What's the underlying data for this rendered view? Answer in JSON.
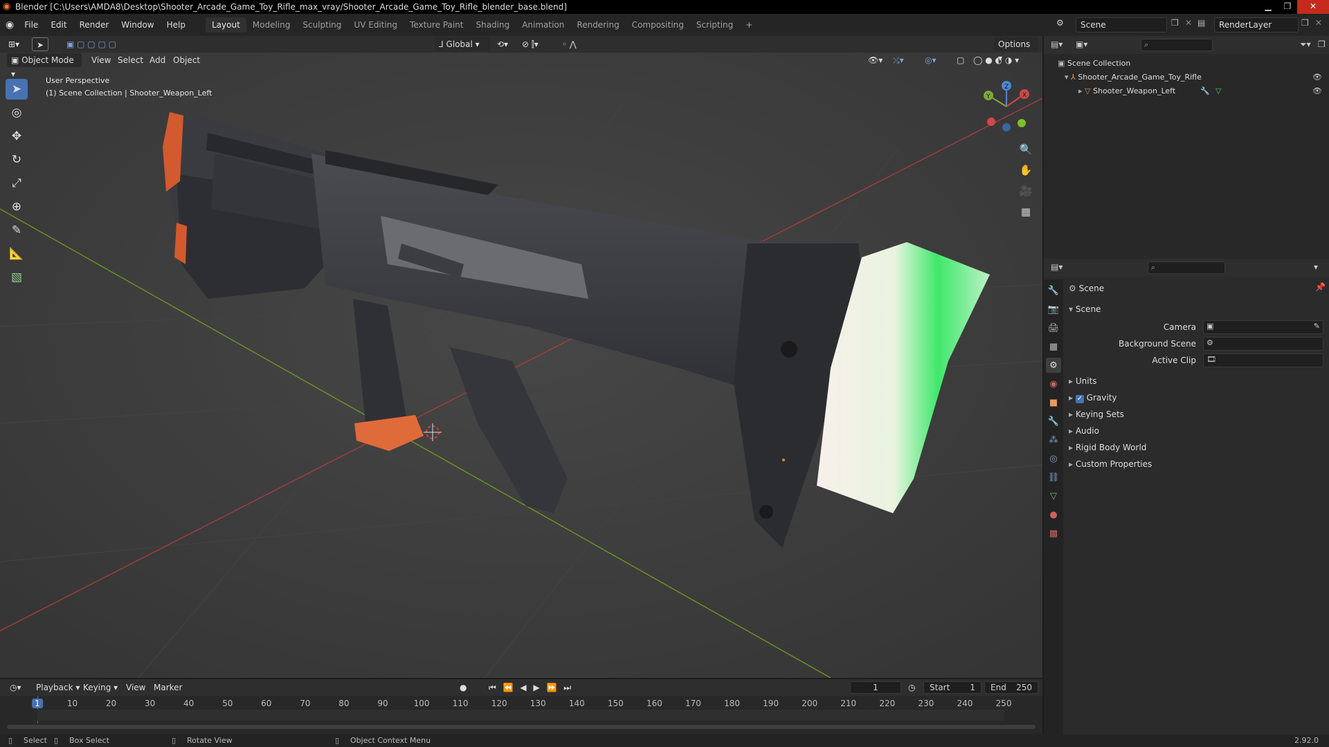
{
  "window": {
    "title": "Blender [C:\\Users\\AMDA8\\Desktop\\Shooter_Arcade_Game_Toy_Rifle_max_vray/Shooter_Arcade_Game_Toy_Rifle_blender_base.blend]"
  },
  "menu": [
    "File",
    "Edit",
    "Render",
    "Window",
    "Help"
  ],
  "workspaces": [
    "Layout",
    "Modeling",
    "Sculpting",
    "UV Editing",
    "Texture Paint",
    "Shading",
    "Animation",
    "Rendering",
    "Compositing",
    "Scripting"
  ],
  "active_workspace": "Layout",
  "add_workspace": "+",
  "scene_selector": {
    "value": "Scene"
  },
  "view_layer_selector": {
    "value": "RenderLayer"
  },
  "viewport": {
    "transform_orientation": "Global",
    "options_label": "Options",
    "mode": "Object Mode",
    "menus": [
      "View",
      "Select",
      "Add",
      "Object"
    ],
    "overlay_line1": "User Perspective",
    "overlay_line2": "(1) Scene Collection | Shooter_Weapon_Left"
  },
  "gizmo": {
    "x": "X",
    "y": "Y",
    "z": "Z"
  },
  "outliner": {
    "root": "Scene Collection",
    "items": [
      {
        "name": "Shooter_Arcade_Game_Toy_Rifle"
      },
      {
        "name": "Shooter_Weapon_Left"
      }
    ]
  },
  "properties": {
    "header_title": "Scene",
    "panel_title": "Scene",
    "fields": [
      {
        "label": "Camera",
        "value": ""
      },
      {
        "label": "Background Scene",
        "value": ""
      },
      {
        "label": "Active Clip",
        "value": ""
      }
    ],
    "panels": [
      "Units",
      "Gravity",
      "Keying Sets",
      "Audio",
      "Rigid Body World",
      "Custom Properties"
    ],
    "gravity_checked": true
  },
  "timeline": {
    "menus": [
      "Playback",
      "Keying",
      "View",
      "Marker"
    ],
    "current_frame": "1",
    "start_label": "Start",
    "start_value": "1",
    "end_label": "End",
    "end_value": "250",
    "ruler": [
      "1",
      "10",
      "20",
      "30",
      "40",
      "50",
      "60",
      "70",
      "80",
      "90",
      "100",
      "110",
      "120",
      "130",
      "140",
      "150",
      "160",
      "170",
      "180",
      "190",
      "200",
      "210",
      "220",
      "230",
      "240",
      "250"
    ]
  },
  "statusbar": {
    "select": "Select",
    "box_select": "Box Select",
    "rotate_view": "Rotate View",
    "context_menu": "Object Context Menu",
    "version": "2.92.0"
  },
  "colors": {
    "accent": "#4772b3",
    "orange": "#e06b3a",
    "green_axis": "#6f9a1f",
    "red_axis": "#b43c3c"
  }
}
